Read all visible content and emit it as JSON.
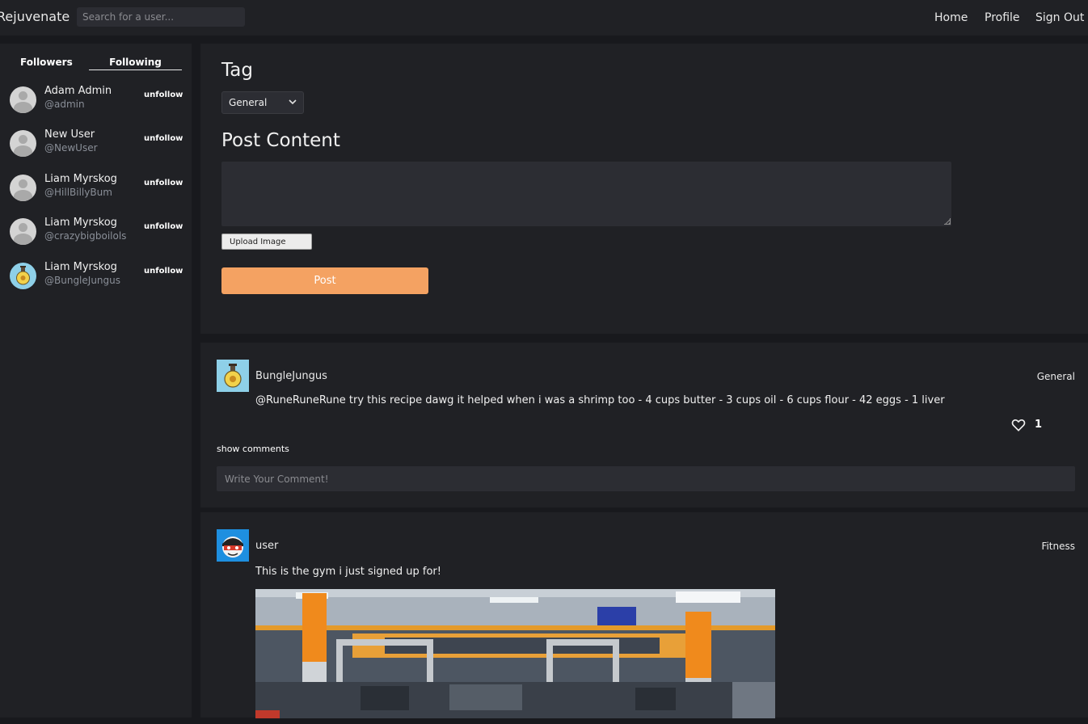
{
  "nav": {
    "brand": "Rejuvenate",
    "search_placeholder": "Search for a user...",
    "links": [
      "Home",
      "Profile",
      "Sign Out"
    ]
  },
  "sidebar": {
    "tabs": [
      "Followers",
      "Following"
    ],
    "active_tab": "Following",
    "unfollow_label": "unfollow",
    "users": [
      {
        "name": "Adam Admin",
        "handle": "@admin",
        "avatar": "default-avatar-icon"
      },
      {
        "name": "New User",
        "handle": "@NewUser",
        "avatar": "default-avatar-icon"
      },
      {
        "name": "Liam Myrskog",
        "handle": "@HillBillyBum",
        "avatar": "default-avatar-icon"
      },
      {
        "name": "Liam Myrskog",
        "handle": "@crazybigboilols",
        "avatar": "default-avatar-icon"
      },
      {
        "name": "Liam Myrskog",
        "handle": "@BungleJungus",
        "avatar": "potion-avatar-icon"
      }
    ]
  },
  "compose": {
    "tag_heading": "Tag",
    "tag_selected": "General",
    "content_heading": "Post Content",
    "content_value": "",
    "upload_label": "Upload Image",
    "post_label": "Post",
    "accent_color": "#f4a262"
  },
  "feed": [
    {
      "username": "BungleJungus",
      "tag": "General",
      "text": "@RuneRuneRune try this recipe dawg it helped when i was a shrimp too - 4 cups butter - 3 cups oil - 6 cups flour - 42 eggs - 1 liver",
      "likes": "1",
      "show_comments": "show comments",
      "comment_placeholder": "Write Your Comment!",
      "avatar": "potion-avatar-icon"
    },
    {
      "username": "user",
      "tag": "Fitness",
      "text": "This is the gym i just signed up for!",
      "avatar": "ninja-avatar-icon",
      "image": "gym-photo"
    }
  ]
}
